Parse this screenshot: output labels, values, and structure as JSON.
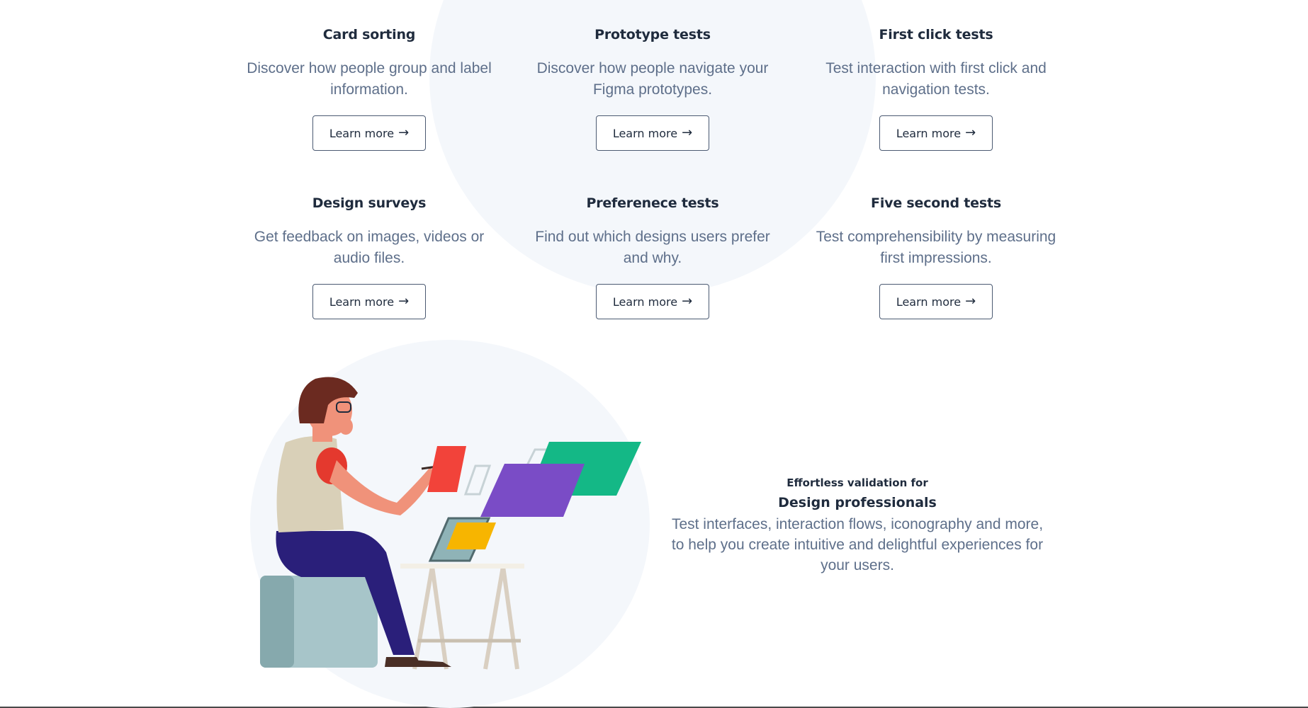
{
  "features": [
    {
      "title": "Card sorting",
      "description": "Discover how people group and label information.",
      "button": "Learn more"
    },
    {
      "title": "Prototype tests",
      "description": "Discover how people navigate your Figma prototypes.",
      "button": "Learn more"
    },
    {
      "title": "First click tests",
      "description": "Test interaction with first click and navigation tests.",
      "button": "Learn more"
    },
    {
      "title": "Design surveys",
      "description": "Get feedback on images, videos or audio files.",
      "button": "Learn more"
    },
    {
      "title": "Preferenece tests",
      "description": "Find out which designs users prefer and why.",
      "button": "Learn more"
    },
    {
      "title": "Five second tests",
      "description": "Test comprehensibility by measuring first impressions.",
      "button": "Learn more"
    }
  ],
  "arrow_glyph": "→",
  "promo": {
    "eyebrow": "Effortless validation for",
    "headline": "Design professionals",
    "body": "Test interfaces, interaction flows, iconography and more, to help you create intuitive and delightful experiences for your users."
  },
  "colors": {
    "heading": "#1f2b3d",
    "body_text": "#5e6f8a",
    "button_border": "#4b5a72",
    "blob": "#f4f7fb"
  }
}
